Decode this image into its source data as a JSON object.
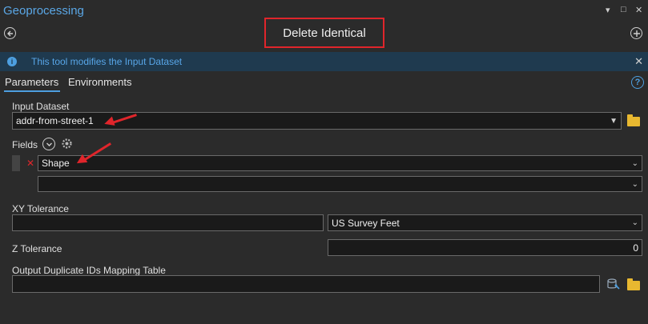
{
  "pane": {
    "title": "Geoprocessing",
    "tool_name": "Delete Identical",
    "info_message": "This tool modifies the Input Dataset"
  },
  "tabs": [
    {
      "label": "Parameters",
      "active": true
    },
    {
      "label": "Environments",
      "active": false
    }
  ],
  "params": {
    "input_dataset": {
      "label": "Input Dataset",
      "value": "addr-from-street-1"
    },
    "fields": {
      "label": "Fields",
      "items": [
        "Shape",
        ""
      ]
    },
    "xy_tolerance": {
      "label": "XY Tolerance",
      "value": "",
      "unit": "US Survey Feet"
    },
    "z_tolerance": {
      "label": "Z Tolerance",
      "value": "0"
    },
    "output_table": {
      "label": "Output Duplicate IDs Mapping Table",
      "value": ""
    }
  },
  "colors": {
    "accent": "#4d9fe0",
    "highlight": "#e0252b",
    "background": "#2b2b2b"
  }
}
